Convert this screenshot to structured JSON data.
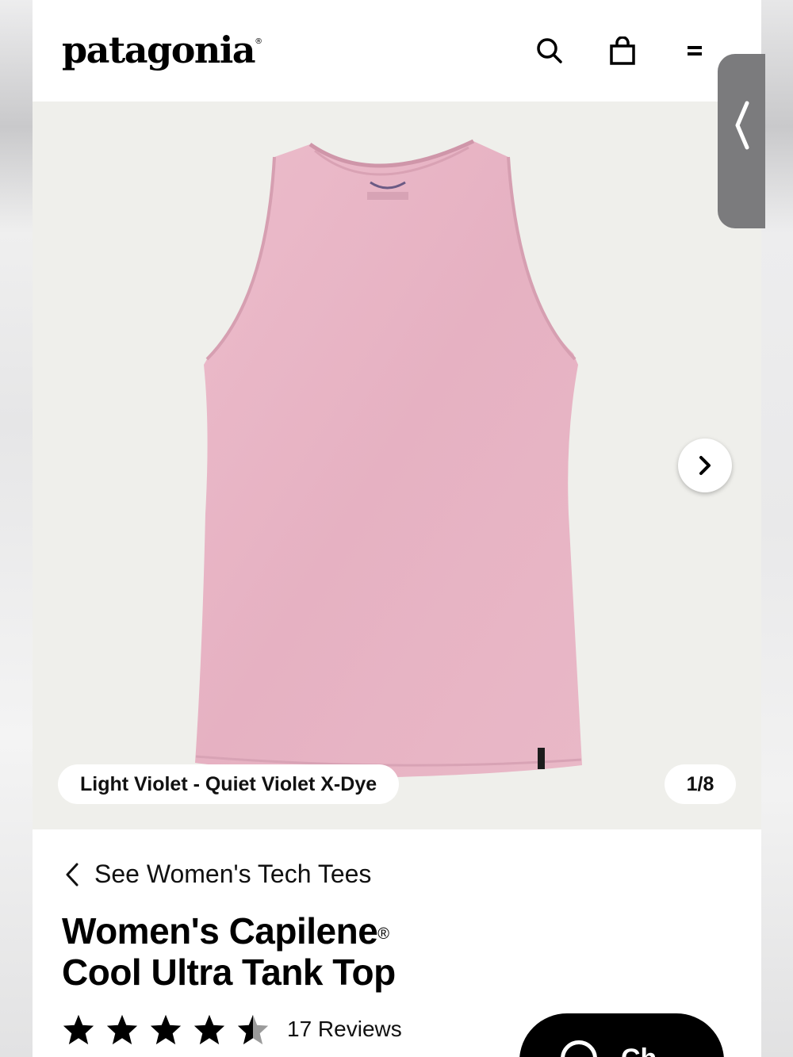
{
  "header": {
    "logo": "patagonia",
    "logo_mark": "®",
    "search_icon": "search-icon",
    "bag_icon": "shopping-bag-icon",
    "menu_icon": "menu-icon"
  },
  "gallery": {
    "color_name": "Light Violet - Quiet Violet X-Dye",
    "counter": "1/8",
    "next_icon": "chevron-right-icon",
    "product_color": "#e8b4c4"
  },
  "drawer": {
    "icon": "chevron-left-icon"
  },
  "details": {
    "back_link": "See Women's Tech Tees",
    "title_line1": "Women's Capilene",
    "title_reg": "®",
    "title_line2": "Cool Ultra Tank Top",
    "rating": 4.5,
    "reviews": "17 Reviews"
  },
  "cta": {
    "label": "Ch"
  }
}
